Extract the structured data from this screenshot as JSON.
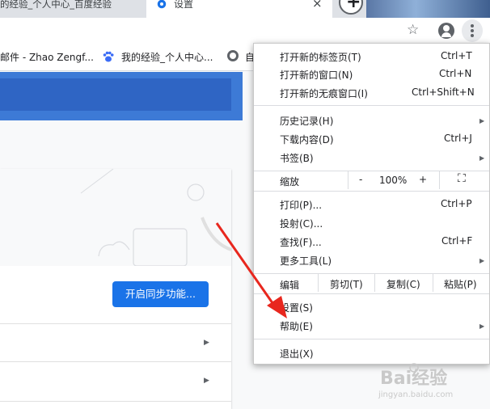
{
  "tabs": {
    "left_title": "的经验_个人中心_百度经验",
    "active_title": "设置",
    "close_glyph": "×",
    "new_tab_glyph": "+"
  },
  "toolbar": {
    "star_glyph": "☆"
  },
  "bookmarks": [
    {
      "label": "邮件 - Zhao Zengf..."
    },
    {
      "label": "我的经验_个人中心..."
    },
    {
      "label": "自"
    }
  ],
  "page": {
    "sync_button": "开启同步功能...",
    "row_chevron": "▶"
  },
  "menu": {
    "items": [
      {
        "label": "打开新的标签页(T)",
        "shortcut": "Ctrl+T"
      },
      {
        "label": "打开新的窗口(N)",
        "shortcut": "Ctrl+N"
      },
      {
        "label": "打开新的无痕窗口(I)",
        "shortcut": "Ctrl+Shift+N"
      },
      {
        "label": "历史记录(H)",
        "shortcut": ""
      },
      {
        "label": "下载内容(D)",
        "shortcut": "Ctrl+J"
      },
      {
        "label": "书签(B)",
        "shortcut": ""
      },
      {
        "label": "打印(P)...",
        "shortcut": "Ctrl+P"
      },
      {
        "label": "投射(C)...",
        "shortcut": ""
      },
      {
        "label": "查找(F)...",
        "shortcut": "Ctrl+F"
      },
      {
        "label": "更多工具(L)",
        "shortcut": ""
      },
      {
        "label": "设置(S)",
        "shortcut": ""
      },
      {
        "label": "帮助(E)",
        "shortcut": ""
      },
      {
        "label": "退出(X)",
        "shortcut": ""
      }
    ],
    "submenu_glyph": "▶",
    "zoom": {
      "label": "缩放",
      "minus": "-",
      "value": "100%",
      "plus": "+",
      "fullscreen_glyph": "⛶"
    },
    "edit": {
      "label": "编辑",
      "cut": "剪切(T)",
      "copy": "复制(C)",
      "paste": "粘贴(P)"
    }
  },
  "watermark": {
    "brand": "Bai经验",
    "url": "jingyan.baidu.com"
  },
  "colors": {
    "accent": "#1a73e8",
    "banner": "#3d7ad6",
    "arrow": "#e8271e"
  }
}
